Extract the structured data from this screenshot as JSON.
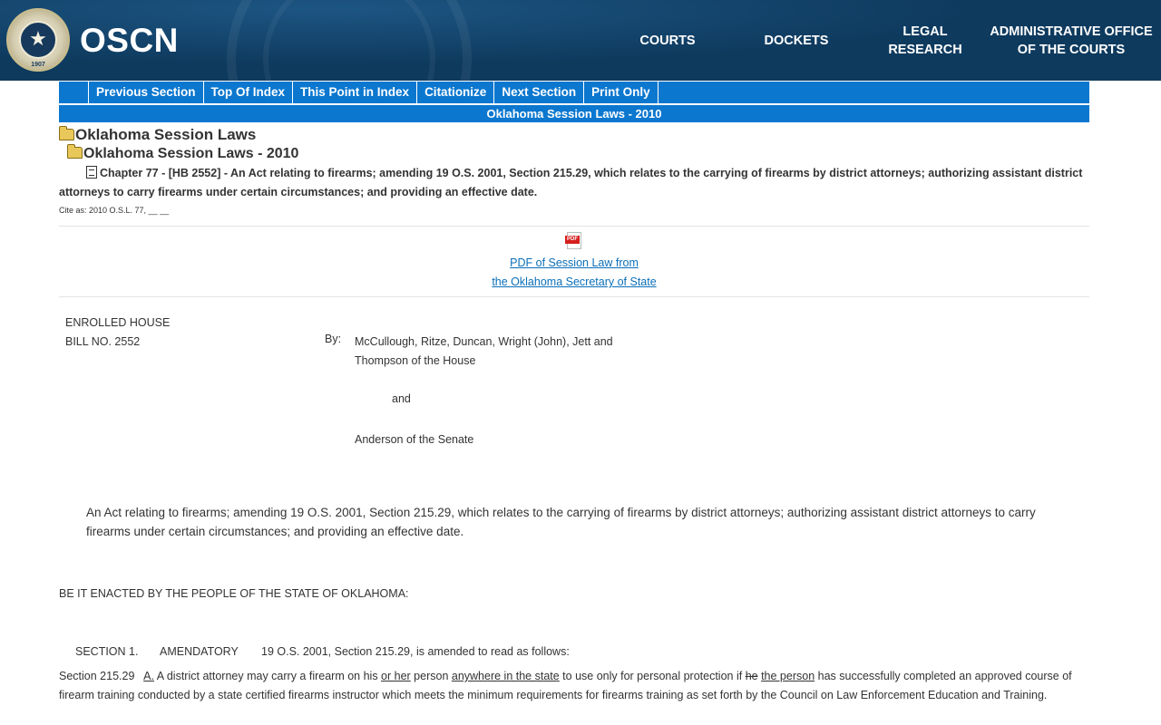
{
  "header": {
    "seal_text": "1907",
    "brand": "OSCN",
    "nav": {
      "courts": "COURTS",
      "dockets": "DOCKETS",
      "legal_line1": "LEGAL",
      "legal_line2": "RESEARCH",
      "admin_line1": "ADMINISTRATIVE OFFICE",
      "admin_line2": "OF THE COURTS"
    }
  },
  "toolbar": {
    "previous_section": "Previous Section",
    "top_of_index": "Top Of Index",
    "this_point_in_index": "This Point in Index",
    "citationize": "Citationize",
    "next_section": "Next Section",
    "print_only": "Print Only"
  },
  "subbar_title": "Oklahoma Session Laws - 2010",
  "breadcrumb": {
    "level1": "Oklahoma Session Laws",
    "level2": "Oklahoma Session Laws - 2010"
  },
  "chapter": {
    "label": "Chapter 77",
    "bill": "[HB 2552]",
    "title": " - An Act relating to firearms; amending 19 O.S. 2001, Section 215.29, which relates to the carrying of firearms by district attorneys; authorizing assistant district attorneys to carry firearms under certain circumstances; and providing an effective date."
  },
  "cite_as": "Cite as: 2010 O.S.L. 77, __ __",
  "pdf": {
    "icon_label": "PDF",
    "link_line1": "PDF of Session Law from",
    "link_line2": "the Oklahoma Secretary of State"
  },
  "bill": {
    "line1": "ENROLLED HOUSE",
    "line2": "BILL NO. 2552",
    "by_label": "By:",
    "sponsors_line1": "McCullough, Ritze, Duncan, Wright (John), Jett and",
    "sponsors_line2": "Thompson of the House",
    "and": "and",
    "senate": "Anderson of the Senate"
  },
  "act_text": "An Act relating to firearms; amending 19 O.S. 2001, Section 215.29, which relates to the carrying of firearms by district attorneys; authorizing assistant district attorneys to carry firearms under certain circumstances; and providing an effective date.",
  "enacted_text": "BE IT ENACTED BY THE PEOPLE OF THE STATE OF OKLAHOMA:",
  "section1": {
    "label": "SECTION 1.",
    "type": "AMENDATORY",
    "text": "19 O.S. 2001, Section 215.29, is amended to read as follows:"
  },
  "section_body": {
    "number": "Section 215.29",
    "sub_a": "A.",
    "t1": " A district attorney may carry a firearm on his ",
    "ins1": "or her",
    "t2": " person ",
    "ins2": "anywhere in the state",
    "t3": " to use only for personal protection if ",
    "del1": "he",
    "t4": " ",
    "ins3": "the person",
    "t5": " has successfully completed an approved course of firearm training conducted by a state certified firearms instructor which meets the minimum requirements for firearms training as set forth by the Council on Law Enforcement Education and Training."
  }
}
